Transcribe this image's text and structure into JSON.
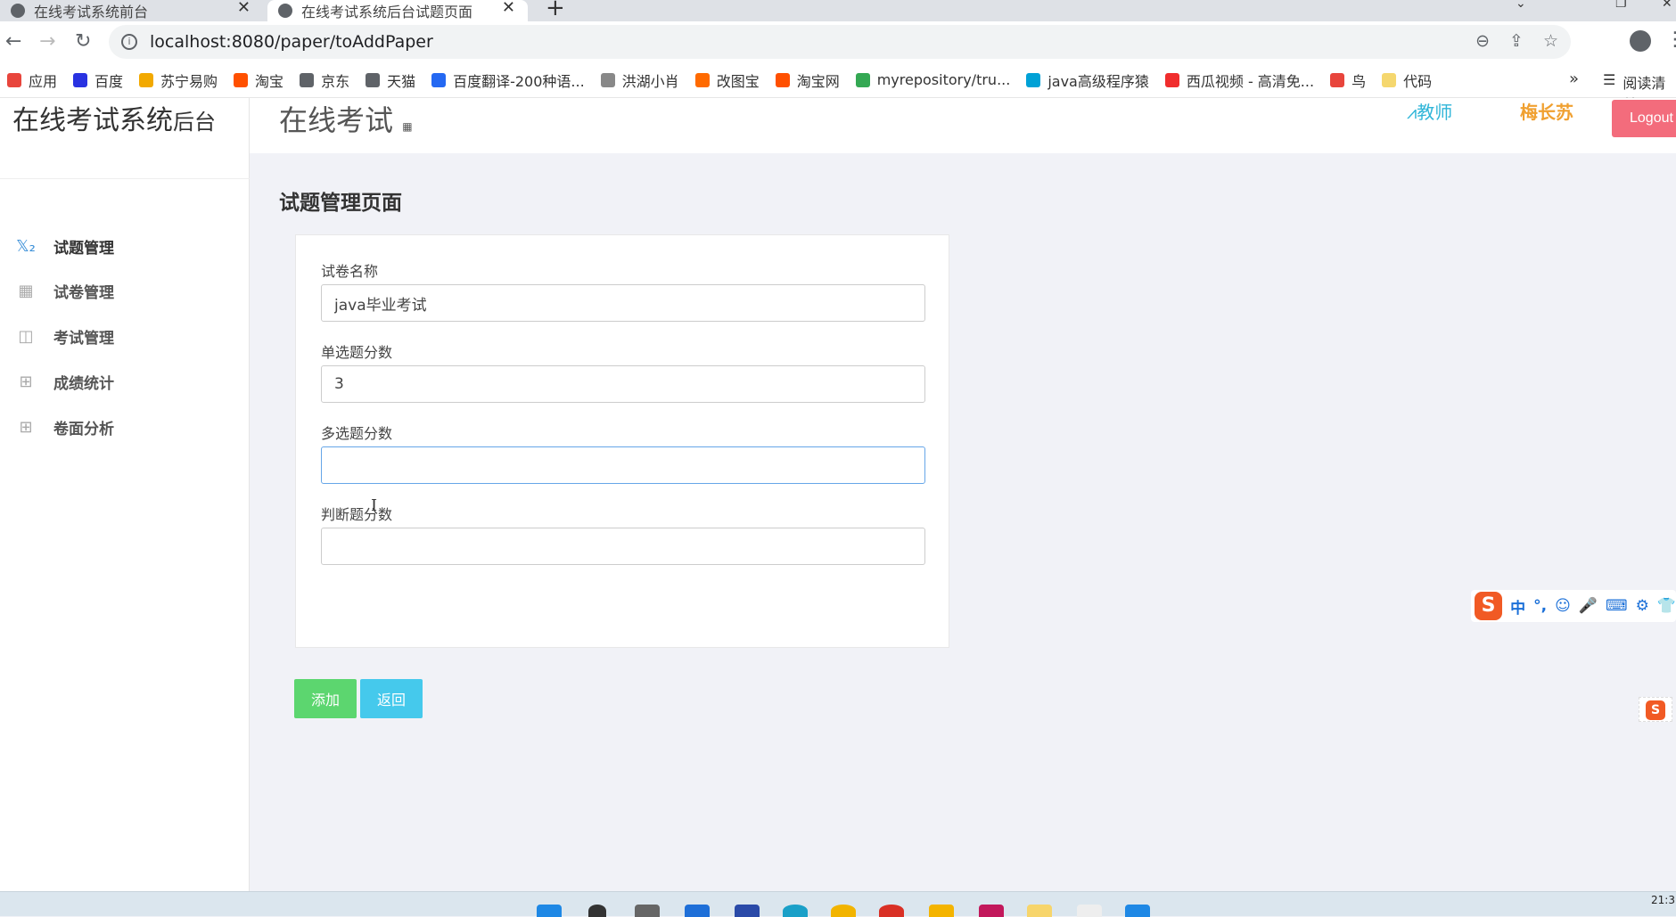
{
  "browser": {
    "tabs": [
      {
        "title": "在线考试系统前台"
      },
      {
        "title": "在线考试系统后台试题页面"
      }
    ],
    "new_tab": "+",
    "close_glyph": "✕",
    "url": "localhost:8080/paper/toAddPaper",
    "bookmarks": [
      {
        "label": "应用",
        "color": "#e8453c"
      },
      {
        "label": "百度",
        "color": "#2932e1"
      },
      {
        "label": "苏宁易购",
        "color": "#f2a900"
      },
      {
        "label": "淘宝",
        "color": "#ff5000"
      },
      {
        "label": "京东",
        "color": "#5f6368"
      },
      {
        "label": "天猫",
        "color": "#5f6368"
      },
      {
        "label": "百度翻译-200种语...",
        "color": "#2468f2"
      },
      {
        "label": "洪湖小肖",
        "color": "#888888"
      },
      {
        "label": "改图宝",
        "color": "#ff6a00"
      },
      {
        "label": "淘宝网",
        "color": "#ff5000"
      },
      {
        "label": "myrepository/tru...",
        "color": "#34a853"
      },
      {
        "label": "java高级程序猿",
        "color": "#00a1d6"
      },
      {
        "label": "西瓜视频 - 高清免...",
        "color": "#f02d2d"
      },
      {
        "label": "鸟",
        "color": "#e8453c"
      },
      {
        "label": "代码",
        "color": "#f5d76e"
      }
    ],
    "bookmarks_more": "»",
    "reading_list": "阅读清单"
  },
  "app": {
    "brand": "在线考试系统",
    "brand_suffix": "后台",
    "title": "在线考试",
    "title_icon": "▦",
    "role": "教师",
    "username": "梅长苏",
    "logout": "Logout",
    "menu": [
      {
        "label": "试题管理",
        "icon": "𝕏₂"
      },
      {
        "label": "试卷管理",
        "icon": "▦"
      },
      {
        "label": "考试管理",
        "icon": "◫"
      },
      {
        "label": "成绩统计",
        "icon": "⊞"
      },
      {
        "label": "卷面分析",
        "icon": "⊞"
      }
    ],
    "page_heading": "试题管理页面",
    "form": {
      "name_label": "试卷名称",
      "name_value": "java毕业考试",
      "single_label": "单选题分数",
      "single_value": "3",
      "multi_label": "多选题分数",
      "multi_value": "",
      "judge_label": "判断题分数",
      "judge_value": ""
    },
    "add_button": "添加",
    "back_button": "返回"
  },
  "ime": {
    "logo": "S",
    "glyphs": [
      "中",
      "°,",
      "☺",
      "🎤",
      "⌨",
      "⚙",
      "👕"
    ]
  },
  "taskbar": {
    "clock": "21:3"
  }
}
